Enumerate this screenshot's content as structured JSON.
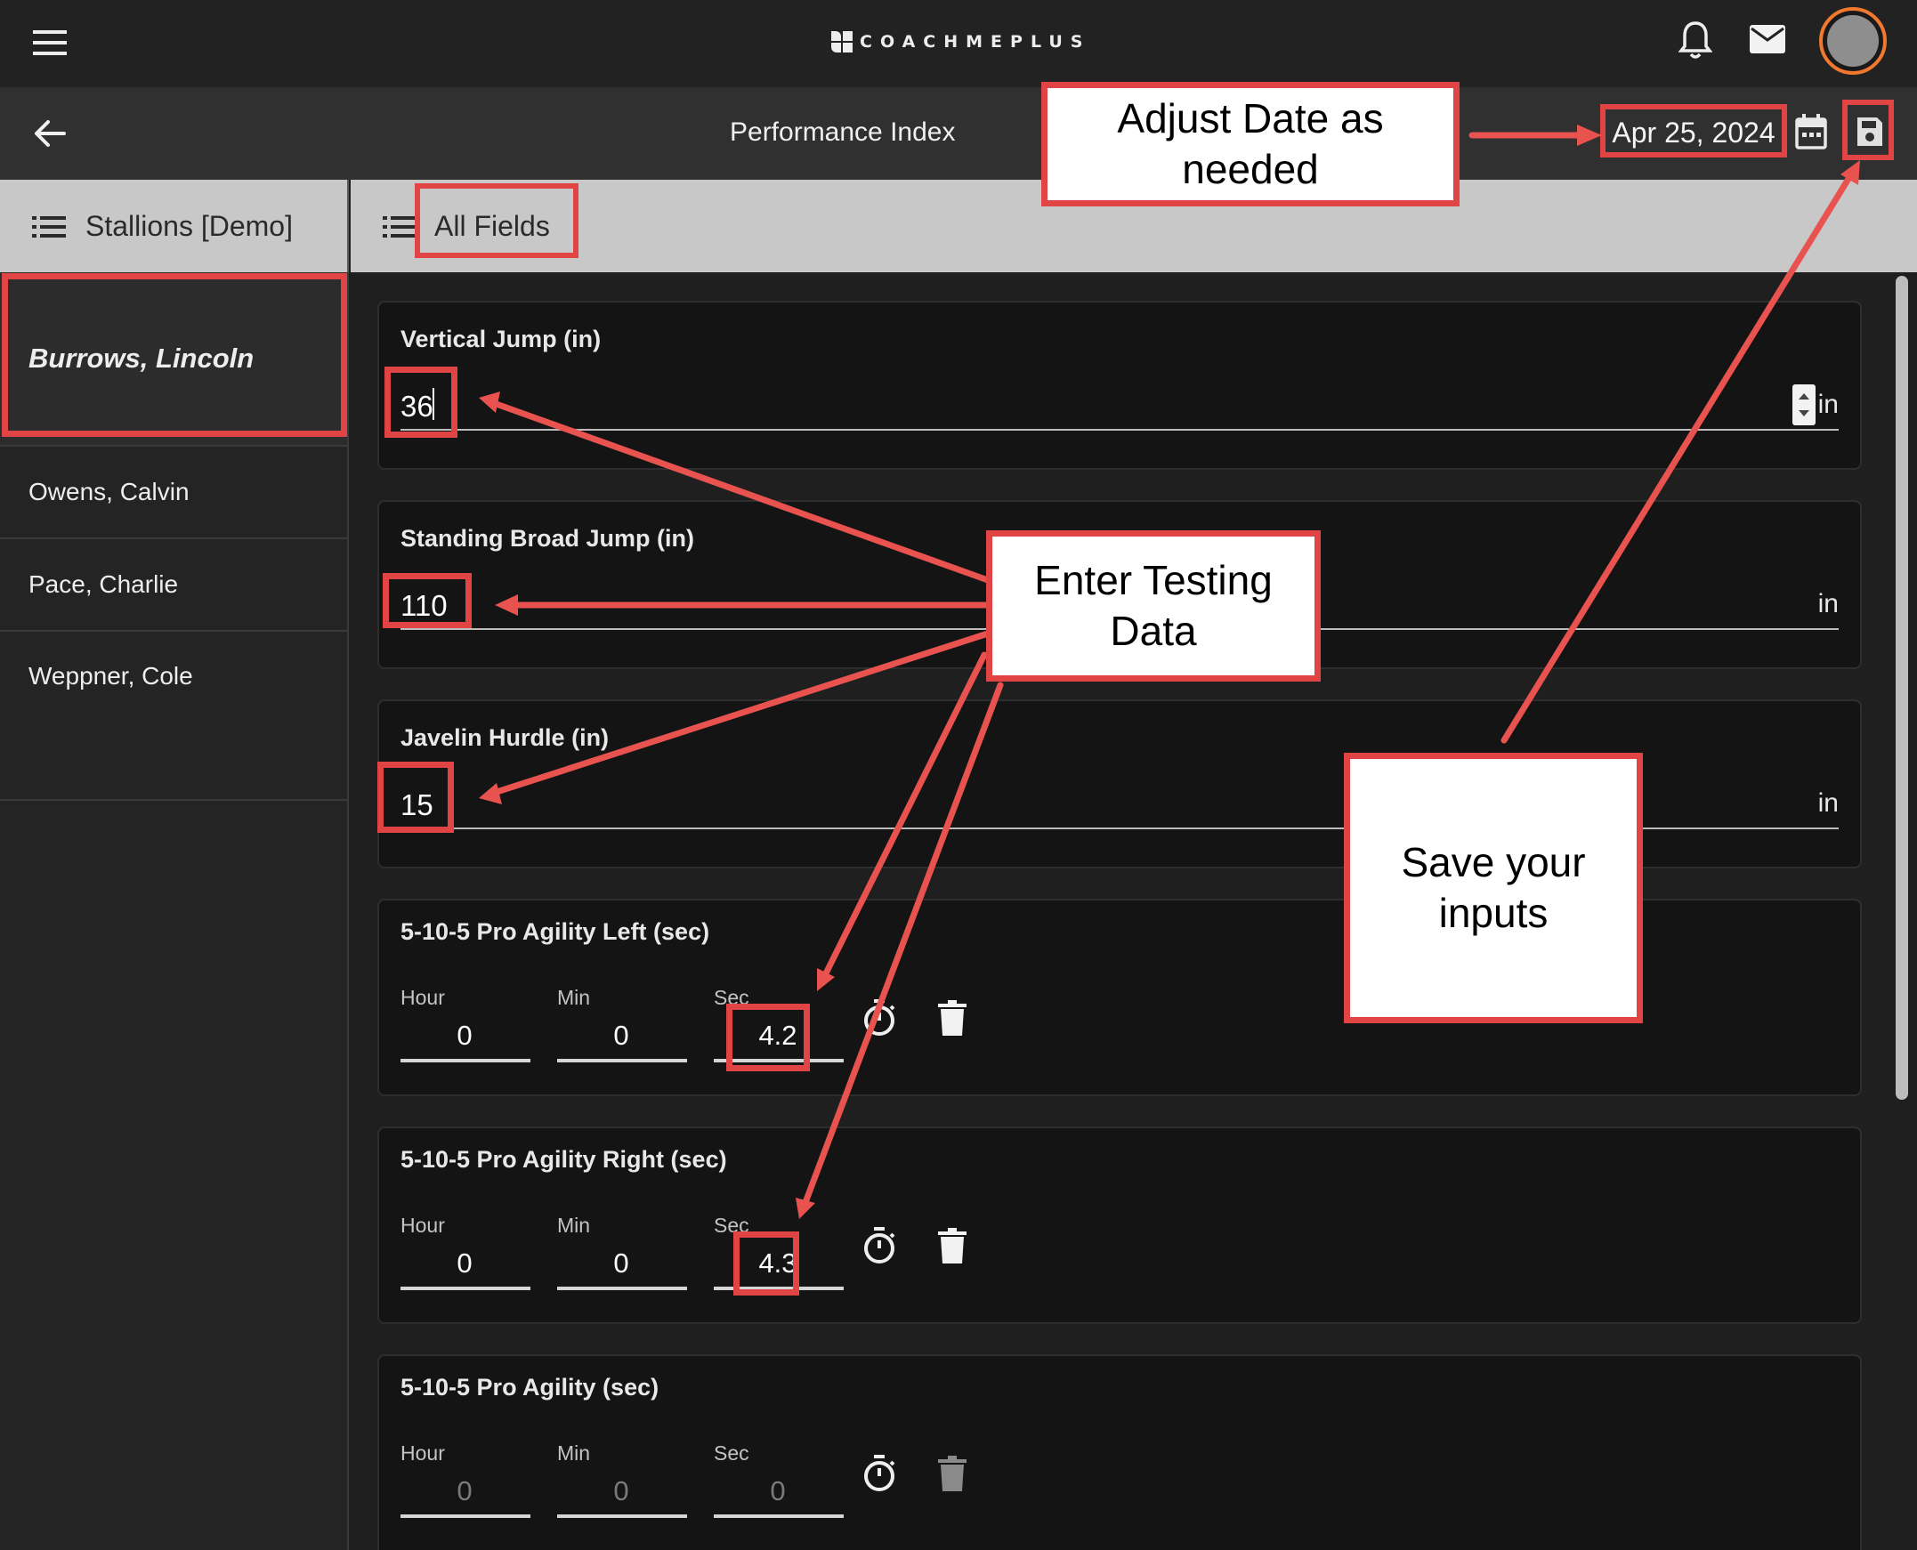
{
  "app": {
    "logo_text": "COACHMEPLUS"
  },
  "header": {
    "title": "Performance Index",
    "date": "Apr 25, 2024"
  },
  "team": {
    "label": "Stallions [Demo]"
  },
  "filter": {
    "label": "All Fields"
  },
  "athletes": [
    {
      "name": "Burrows, Lincoln",
      "selected": true
    },
    {
      "name": "Owens, Calvin"
    },
    {
      "name": "Pace, Charlie"
    },
    {
      "name": "Weppner, Cole"
    }
  ],
  "fields": [
    {
      "label": "Vertical Jump (in)",
      "value": "36",
      "unit": "in"
    },
    {
      "label": "Standing Broad Jump (in)",
      "value": "110",
      "unit": "in"
    },
    {
      "label": "Javelin Hurdle (in)",
      "value": "15",
      "unit": "in"
    }
  ],
  "timed_fields": [
    {
      "label": "5-10-5 Pro Agility Left (sec)",
      "hour_label": "Hour",
      "min_label": "Min",
      "sec_label": "Sec",
      "hour": "0",
      "min": "0",
      "sec": "4.2"
    },
    {
      "label": "5-10-5 Pro Agility Right (sec)",
      "hour_label": "Hour",
      "min_label": "Min",
      "sec_label": "Sec",
      "hour": "0",
      "min": "0",
      "sec": "4.3"
    },
    {
      "label": "5-10-5 Pro Agility (sec)",
      "hour_label": "Hour",
      "min_label": "Min",
      "sec_label": "Sec",
      "hour": "0",
      "min": "0",
      "sec": "0"
    }
  ],
  "annotations": {
    "date_note": "Adjust Date as needed",
    "data_note": "Enter Testing Data",
    "save_note": "Save your inputs"
  },
  "icons": [
    "menu-icon",
    "bell-icon",
    "mail-icon",
    "avatar",
    "back-arrow-icon",
    "calendar-icon",
    "save-icon",
    "list-icon",
    "stopwatch-icon",
    "trash-icon"
  ],
  "colors": {
    "annotation_red": "#e04444",
    "avatar_ring": "#f0782f",
    "header_bg": "#222222",
    "filter_bar_bg": "#c8c8c8"
  }
}
